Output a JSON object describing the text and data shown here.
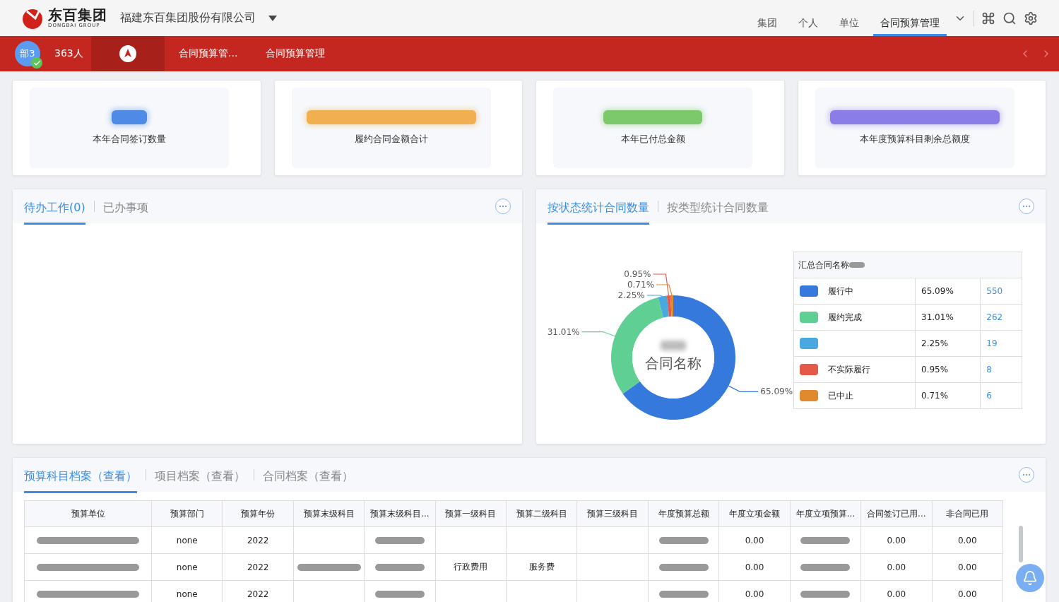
{
  "header": {
    "brand": "东百集团",
    "brand_sub": "DONGBAI GROUP",
    "company": "福建东百集团股份有限公司",
    "nav": [
      {
        "label": "集团",
        "selected": false
      },
      {
        "label": "个人",
        "selected": false
      },
      {
        "label": "单位",
        "selected": false
      },
      {
        "label": "合同预算管理",
        "selected": true
      }
    ]
  },
  "redbar": {
    "avatar": "部3",
    "members": "363人",
    "tabs": [
      {
        "label": "合同预算管...",
        "selected": false
      },
      {
        "label": "合同预算管理",
        "selected": false
      }
    ]
  },
  "kpis": [
    {
      "label": "本年合同签订数量",
      "color": "#4f8be6"
    },
    {
      "label": "履约合同金额合计",
      "color": "#f0b050"
    },
    {
      "label": "本年已付总金额",
      "color": "#7cc96b"
    },
    {
      "label": "本年度预算科目剩余总额度",
      "color": "#8a7de8"
    }
  ],
  "todo": {
    "tabs": [
      {
        "label": "待办工作(0)",
        "selected": true
      },
      {
        "label": "已办事项",
        "selected": false
      }
    ]
  },
  "stats": {
    "tabs": [
      {
        "label": "按状态统计合同数量",
        "selected": true
      },
      {
        "label": "按类型统计合同数量",
        "selected": false
      }
    ],
    "chart_data": {
      "type": "donut",
      "title": "合同名称",
      "values": [
        65.09,
        31.01,
        2.25,
        0.95,
        0.71
      ],
      "value_labels": [
        "65.09%",
        "31.01%",
        "2.25%",
        "0.95%",
        "0.71%"
      ]
    },
    "legend_title": "汇总合同名称",
    "legend": [
      {
        "label": "履行中",
        "color": "#3479db",
        "percent": "65.09%",
        "count": "550"
      },
      {
        "label": "履约完成",
        "color": "#5fcf93",
        "percent": "31.01%",
        "count": "262"
      },
      {
        "color": "#4aa8e0",
        "percent": "2.25%",
        "count": "19"
      },
      {
        "label": "不实际履行",
        "color": "#e35a48",
        "percent": "0.95%",
        "count": "8"
      },
      {
        "label": "已中止",
        "color": "#e08a30",
        "percent": "0.71%",
        "count": "6"
      }
    ]
  },
  "archive": {
    "tabs": [
      {
        "label": "预算科目档案（查看）",
        "selected": true
      },
      {
        "label": "项目档案（查看）",
        "selected": false
      },
      {
        "label": "合同档案（查看）",
        "selected": false
      }
    ],
    "table": {
      "columns": [
        "预算单位",
        "预算部门",
        "预算年份",
        "预算末级科目",
        "预算末级科目...",
        "预算一级科目",
        "预算二级科目",
        "预算三级科目",
        "年度预算总额",
        "年度立项金额",
        "年度立项预算...",
        "合同签订已用...",
        "非合同已用"
      ],
      "rows": [
        [
          {
            "redacted": true
          },
          {
            "text": "none"
          },
          {
            "text": "2022"
          },
          {},
          {
            "redacted": true
          },
          {},
          {},
          {},
          {
            "redacted": true
          },
          {
            "text": "0.00"
          },
          {
            "redacted": true
          },
          {
            "text": "0.00"
          },
          {
            "text": "0.00"
          }
        ],
        [
          {
            "redacted": true
          },
          {
            "text": "none"
          },
          {
            "text": "2022"
          },
          {
            "redacted": true
          },
          {
            "redacted": true
          },
          {
            "text": "行政费用"
          },
          {
            "text": "服务费"
          },
          {},
          {
            "redacted": true
          },
          {
            "text": "0.00"
          },
          {
            "redacted": true
          },
          {
            "text": "0.00"
          },
          {
            "text": "0.00"
          }
        ],
        [
          {
            "redacted": true
          },
          {
            "text": "none"
          },
          {
            "text": "2022"
          },
          {},
          {
            "redacted": true
          },
          {},
          {},
          {},
          {
            "redacted": true
          },
          {
            "text": "0.00"
          },
          {
            "redacted": true
          },
          {
            "text": "0.00"
          },
          {
            "text": "0.00"
          }
        ]
      ]
    }
  }
}
